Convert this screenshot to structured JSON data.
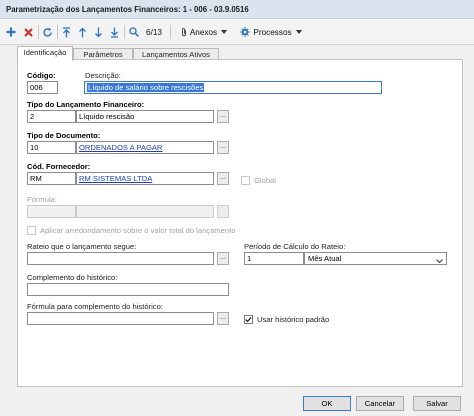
{
  "window": {
    "title": "Parametrização dos Lançamentos Financeiros: 1 - 006 - 03.9.0516"
  },
  "toolbar": {
    "record_counter": "6/13",
    "anexos_label": "Anexos",
    "processos_label": "Processos"
  },
  "tabs": [
    {
      "label": "Identificação"
    },
    {
      "label": "Parâmetros"
    },
    {
      "label": "Lançamentos Ativos"
    }
  ],
  "form": {
    "codigo": {
      "label": "Código:",
      "value": "006"
    },
    "descricao": {
      "label": "Descrição:",
      "value": "Líquido de salário sobre rescisões"
    },
    "tipo_lancamento": {
      "label": "Tipo do Lançamento Financeiro:",
      "code": "2",
      "name": "Líquido rescisão"
    },
    "tipo_documento": {
      "label": "Tipo de Documento:",
      "code": "10",
      "name": "ORDENADOS A PAGAR"
    },
    "fornecedor": {
      "label": "Cód. Fornecedor:",
      "code": "RM",
      "name": "RM SISTEMAS LTDA"
    },
    "global": {
      "label": "Global",
      "checked": false
    },
    "formula": {
      "label": "Fórmula:",
      "value": ""
    },
    "arredondamento": {
      "label": "Aplicar arredondamento sobre o valor total do lançamento",
      "checked": false
    },
    "rateio": {
      "label": "Rateio que o lançamento segue:",
      "value": ""
    },
    "periodo_rateio": {
      "label": "Período de Cálculo do Rateio:",
      "value": "1",
      "option": "Mês Atual"
    },
    "complemento_historico": {
      "label": "Complemento do histórico:",
      "value": ""
    },
    "formula_complemento": {
      "label": "Fórmula para complemento do histórico:",
      "value": ""
    },
    "historico_padrao": {
      "label": "Usar histórico padrão",
      "checked": true
    },
    "ellipsis": "..."
  },
  "buttons": {
    "ok": "OK",
    "cancelar": "Cancelar",
    "salvar": "Salvar"
  },
  "colors": {
    "titlebar": "#dbe3ee",
    "selection": "#3b79d8",
    "link": "#1f3fbf",
    "save_icon": "#3277c4",
    "delete_icon": "#d02a2a"
  }
}
